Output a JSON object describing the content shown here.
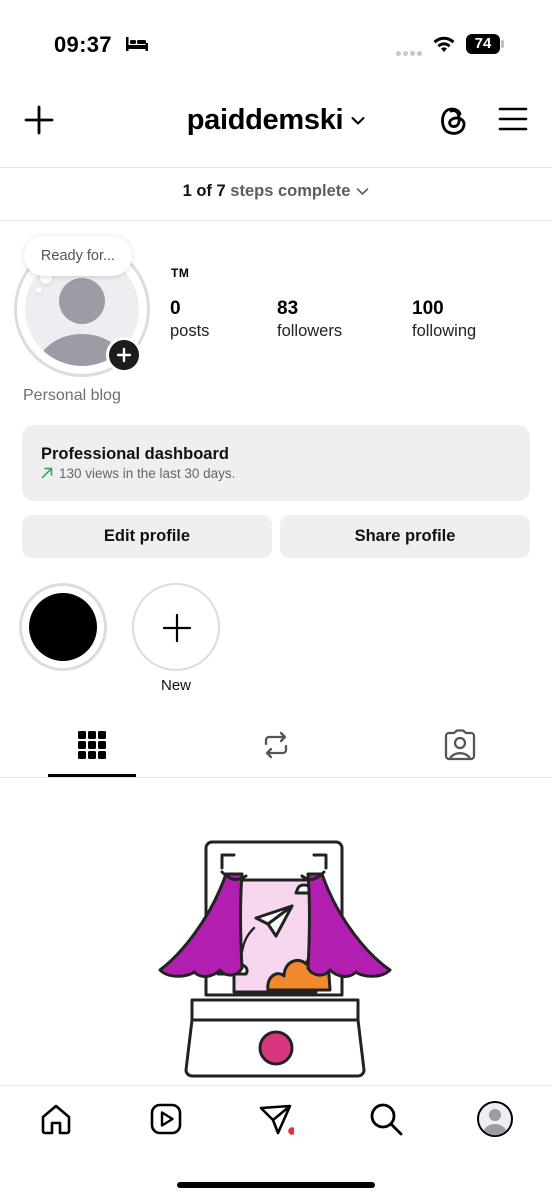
{
  "status_bar": {
    "time": "09:37",
    "battery": "74",
    "icons": [
      "bed-icon",
      "signal-dots-icon",
      "wifi-icon",
      "battery-icon"
    ]
  },
  "header": {
    "username": "paiddemski",
    "icons": [
      "plus-icon",
      "chevron-down-icon",
      "threads-icon",
      "menu-icon"
    ]
  },
  "steps": {
    "done": "1",
    "of": "of",
    "total": "7",
    "label": "steps complete"
  },
  "profile": {
    "note": "Ready for...",
    "name_badge": "TM",
    "stats": [
      {
        "value": "0",
        "label": "posts"
      },
      {
        "value": "83",
        "label": "followers"
      },
      {
        "value": "100",
        "label": "following"
      }
    ],
    "bio": "Personal blog"
  },
  "dashboard": {
    "title": "Professional dashboard",
    "subtitle": "130 views in the last 30 days."
  },
  "buttons": {
    "edit": "Edit profile",
    "share": "Share profile"
  },
  "highlights": {
    "new_label": "New"
  },
  "tabs": [
    "grid-icon",
    "reposts-icon",
    "tagged-icon"
  ],
  "bottom_nav": [
    "home-icon",
    "reels-icon",
    "messages-icon",
    "search-icon",
    "profile-icon"
  ],
  "colors": {
    "accent_purple": "#b21fb0",
    "orange": "#f08a2c",
    "sky_pink": "#f7d6ef",
    "notification_dot": "#ed2d3c",
    "panel_gray": "#efeff2",
    "trend_green": "#2e9e4f"
  }
}
